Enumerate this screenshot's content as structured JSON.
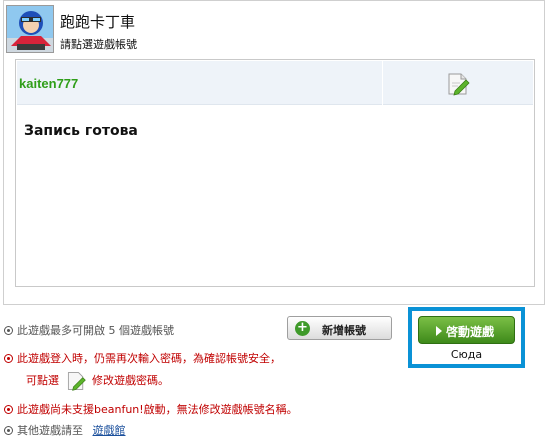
{
  "header": {
    "title": "跑跑卡丁車",
    "subtitle": "請點選遊戲帳號"
  },
  "accounts": [
    {
      "name": "kaiten777",
      "status": "Запись готова"
    }
  ],
  "actions": {
    "add_account_label": "新增帳號",
    "launch_label": "啓動遊戲",
    "launch_caption": "Сюда"
  },
  "info": {
    "max_accounts": "此遊戲最多可開啟 5 個遊戲帳號",
    "password_warning": "此遊戲登入時，仍需再次輸入密碼，為確認帳號安全，",
    "password_hint_prefix": "可點選",
    "password_hint_suffix": "修改遊戲密碼。",
    "beanfun_warning": "此遊戲尚未支援beanfun!啟動，無法修改遊戲帳號名稱。",
    "other_games_prefix": "其他遊戲請至",
    "other_games_link": "遊戲館"
  },
  "colors": {
    "account_green": "#2f9e19",
    "warning_red": "#c00000",
    "launch_green": "#3e8a1a",
    "highlight_blue": "#0a92d6"
  },
  "icons": [
    "game-icon",
    "edit-pencil-icon",
    "plus-icon",
    "play-icon",
    "bullet-icon"
  ]
}
